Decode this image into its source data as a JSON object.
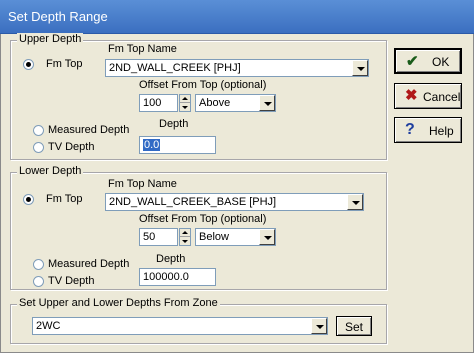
{
  "window": {
    "title": "Set Depth Range"
  },
  "upper": {
    "legend": "Upper Depth",
    "fm_top_label": "Fm Top",
    "fm_top_name_label": "Fm Top Name",
    "fm_top_name_value": "2ND_WALL_CREEK  [PHJ]",
    "offset_label": "Offset From Top (optional)",
    "offset_value": "100",
    "direction_value": "Above",
    "measured_depth_label": "Measured Depth",
    "tv_depth_label": "TV Depth",
    "depth_label": "Depth",
    "depth_value": "0.0",
    "selected_option": "Fm Top"
  },
  "lower": {
    "legend": "Lower Depth",
    "fm_top_label": "Fm Top",
    "fm_top_name_label": "Fm Top Name",
    "fm_top_name_value": "2ND_WALL_CREEK_BASE  [PHJ]",
    "offset_label": "Offset From Top (optional)",
    "offset_value": "50",
    "direction_value": "Below",
    "measured_depth_label": "Measured Depth",
    "tv_depth_label": "TV Depth",
    "depth_label": "Depth",
    "depth_value": "100000.0",
    "selected_option": "Fm Top"
  },
  "zone": {
    "legend": "Set Upper and Lower Depths From Zone",
    "value": "2WC",
    "set_label": "Set"
  },
  "buttons": {
    "ok_label": "OK",
    "cancel_label": "Cancel",
    "help_label": "Help"
  },
  "icons": {
    "ok_icon": "check-icon",
    "cancel_icon": "x-icon",
    "help_icon": "question-icon"
  },
  "colors": {
    "title_bar": "#3b6fc0",
    "dialog_bg": "#ece9d8",
    "ok_check": "#1a5c1a",
    "cancel_x": "#b01818",
    "help_question": "#1f3f9f",
    "selection": "#316ac5"
  }
}
